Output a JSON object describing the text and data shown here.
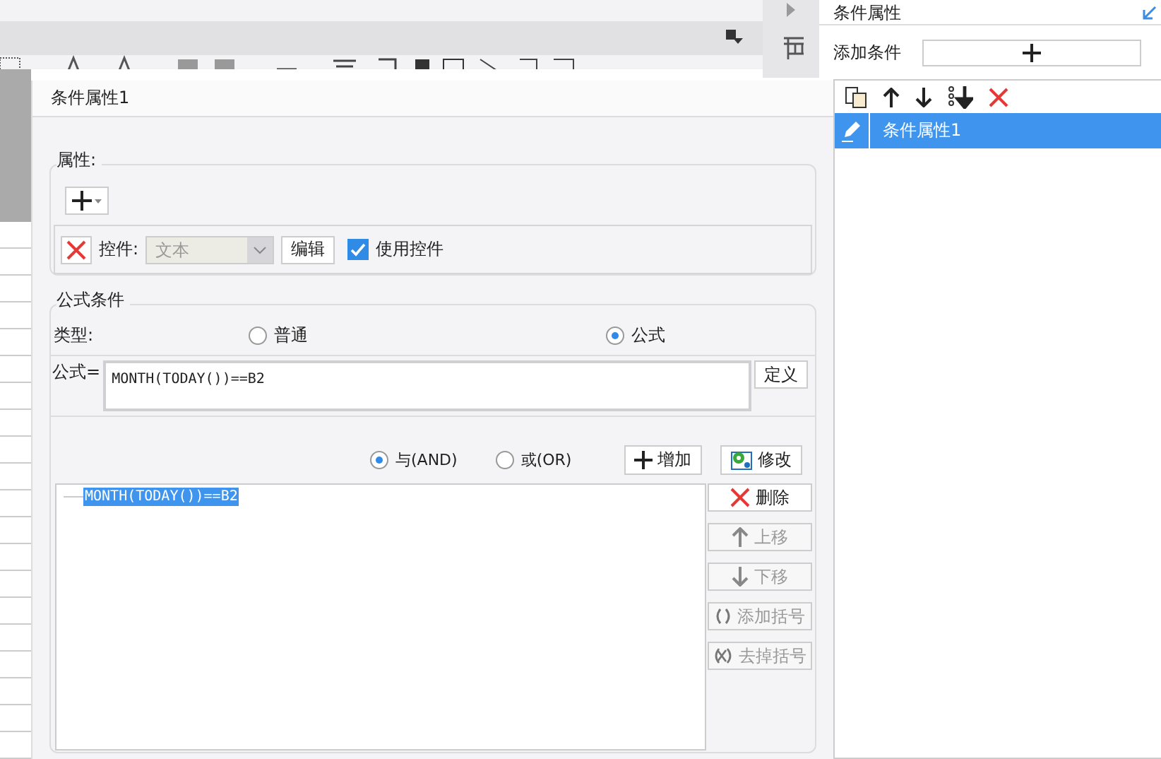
{
  "dialog": {
    "title": "条件属性1",
    "attributes": {
      "label": "属性:",
      "control_label": "控件:",
      "control_select": {
        "value": "文本",
        "disabled": true
      },
      "edit_button": "编辑",
      "use_control": {
        "label": "使用控件",
        "checked": true
      }
    },
    "formula_condition": {
      "label": "公式条件",
      "type_label": "类型:",
      "types": [
        {
          "label": "普通",
          "selected": false
        },
        {
          "label": "公式",
          "selected": true
        }
      ],
      "formula_label": "公式=",
      "formula": "MONTH(TODAY())==B2",
      "define_button": "定义",
      "joins": [
        {
          "label": "与(AND)",
          "selected": true
        },
        {
          "label": "或(OR)",
          "selected": false
        }
      ],
      "add_button": "增加",
      "modify_button": "修改",
      "conditions": [
        {
          "text": "MONTH(TODAY())==B2",
          "selected": true
        }
      ],
      "side_buttons": [
        {
          "label": "删除",
          "kind": "delete",
          "disabled": false
        },
        {
          "label": "上移",
          "kind": "up",
          "disabled": true
        },
        {
          "label": "下移",
          "kind": "down",
          "disabled": true
        },
        {
          "label": "添加括号",
          "kind": "add-paren",
          "disabled": true
        },
        {
          "label": "去掉括号",
          "kind": "remove-paren",
          "disabled": true
        }
      ]
    }
  },
  "side_panel": {
    "title": "条件属性",
    "add_condition_label": "添加条件",
    "items": [
      {
        "label": "条件属性1",
        "selected": true
      }
    ]
  }
}
